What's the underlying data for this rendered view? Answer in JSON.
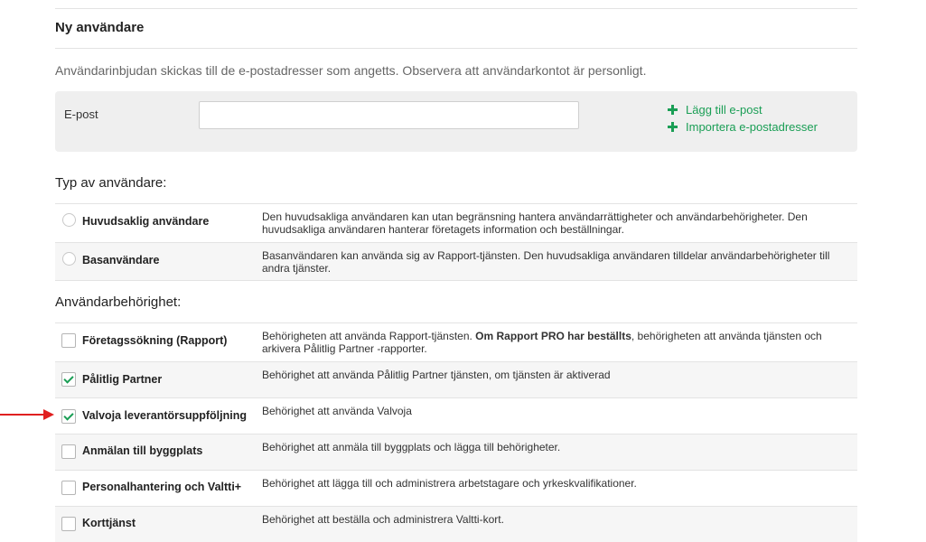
{
  "new_user": {
    "title": "Ny användare",
    "intro": "Användarinbjudan skickas till de e-postadresser som angetts. Observera att användarkontot är personligt.",
    "email_label": "E-post",
    "email_value": "",
    "add_email": "Lägg till e-post",
    "import_emails": "Importera e-postadresser"
  },
  "user_type": {
    "heading": "Typ av användare:",
    "options": [
      {
        "label": "Huvudsaklig användare",
        "desc": "Den huvudsakliga användaren kan utan begränsning hantera användarrättigheter och användarbehörigheter. Den huvudsakliga användaren hanterar företagets information och beställningar."
      },
      {
        "label": "Basanvändare",
        "desc": "Basanvändaren kan använda sig av Rapport-tjänsten. Den huvudsakliga användaren tilldelar användarbehörigheter till andra tjänster."
      }
    ]
  },
  "permissions": {
    "heading": "Användarbehörighet:",
    "items": [
      {
        "label": "Företagssökning (Rapport)",
        "desc_pre": "Behörigheten att använda Rapport-tjänsten. ",
        "desc_bold": "Om Rapport PRO har beställts",
        "desc_post": ", behörigheten att använda tjänsten och arkivera Pålitlig Partner -rapporter.",
        "checked": false
      },
      {
        "label": "Pålitlig Partner",
        "desc": "Behörighet att använda Pålitlig Partner tjänsten, om tjänsten är aktiverad",
        "checked": true
      },
      {
        "label": "Valvoja leverantörsuppföljning",
        "desc": "Behörighet att använda Valvoja",
        "checked": true
      },
      {
        "label": "Anmälan till byggplats",
        "desc": "Behörighet att anmäla till byggplats och lägga till behörigheter.",
        "checked": false
      },
      {
        "label": "Personalhantering och Valtti+",
        "desc": "Behörighet att lägga till och administrera arbetstagare och yrkeskvalifikationer.",
        "checked": false
      },
      {
        "label": "Korttjänst",
        "desc": "Behörighet att beställa och administrera Valtti-kort.",
        "checked": false
      }
    ]
  },
  "colors": {
    "accent_green": "#1a9e55",
    "annotation_arrow": "#e02020"
  },
  "icons": {
    "add": "plus-icon",
    "annotation": "red-arrow-icon"
  }
}
